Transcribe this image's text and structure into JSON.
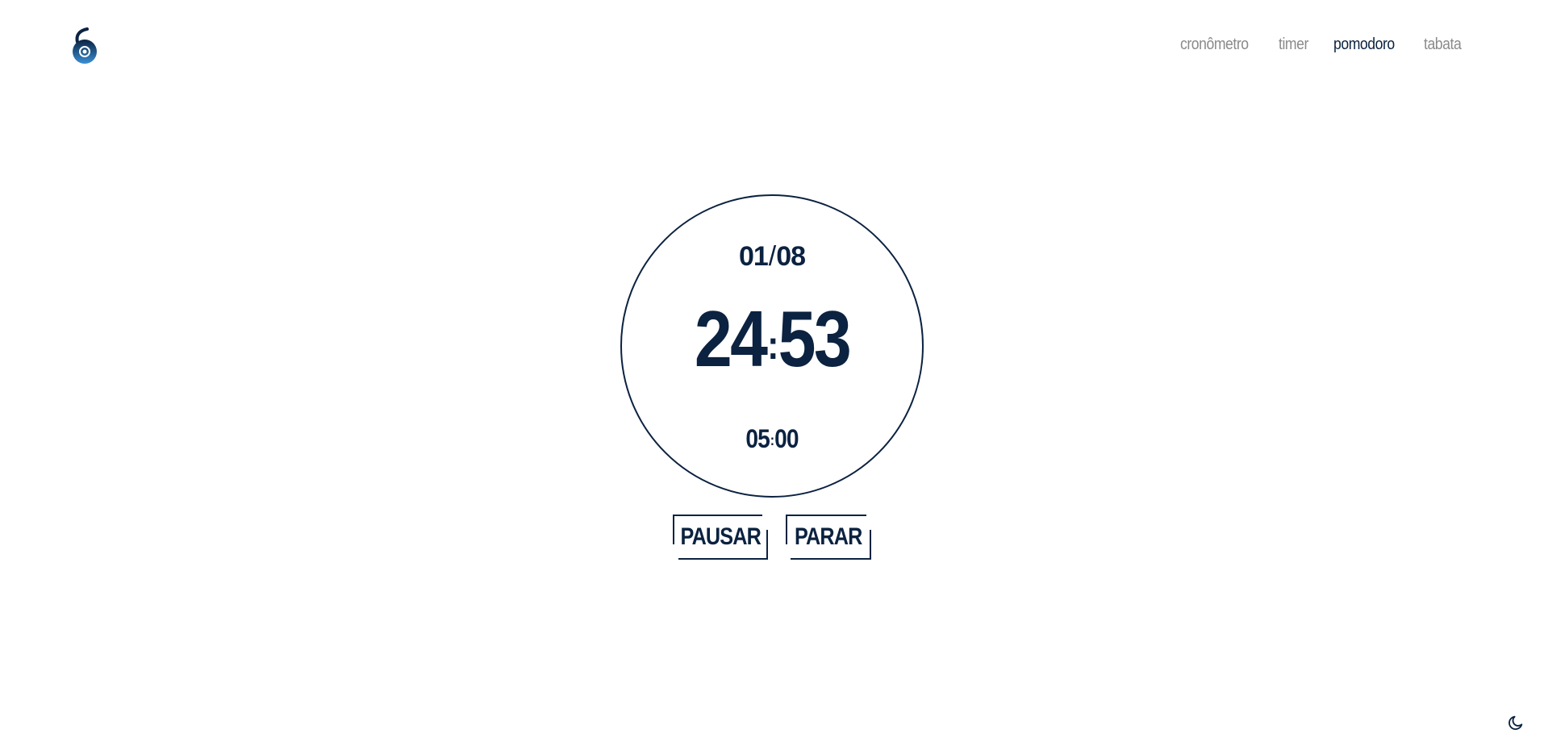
{
  "nav": {
    "items": [
      {
        "label": "cronômetro",
        "active": false
      },
      {
        "label": "timer",
        "active": false
      },
      {
        "label": "pomodoro",
        "active": true
      },
      {
        "label": "tabata",
        "active": false
      }
    ]
  },
  "timer": {
    "round_current": "01",
    "round_separator": "/",
    "round_total": "08",
    "main_minutes": "24",
    "main_seconds": "53",
    "break_minutes": "05",
    "break_seconds": "00"
  },
  "controls": {
    "pause_label": "PAUSAR",
    "stop_label": "PARAR"
  },
  "icons": {
    "logo": "brand-logo",
    "theme": "moon-icon"
  },
  "colors": {
    "accent": "#0b2240",
    "muted_nav": "#8a8a8a",
    "logo_blue": "#2f7fc1"
  }
}
